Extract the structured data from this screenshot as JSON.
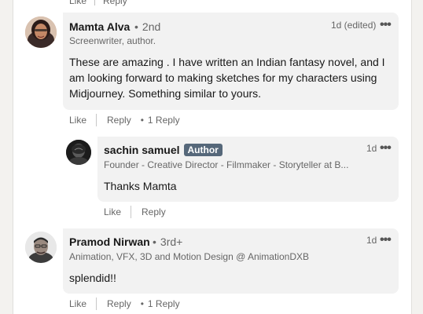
{
  "top_actions": {
    "like": "Like",
    "reply": "Reply"
  },
  "comments": [
    {
      "name": "Mamta Alva",
      "degree": "2nd",
      "headline": "Screenwriter, author.",
      "time": "1d (edited)",
      "text": "These are amazing . I have written an Indian fantasy novel, and I am looking forward to making sketches for my characters using Midjourney. Something similar to yours.",
      "like": "Like",
      "reply": "Reply",
      "replies": "1 Reply",
      "reply_item": {
        "name": "sachin samuel",
        "badge": "Author",
        "headline": "Founder - Creative Director - Filmmaker - Storyteller at B...",
        "time": "1d",
        "text": "Thanks Mamta",
        "like": "Like",
        "reply": "Reply"
      }
    },
    {
      "name": "Pramod Nirwan",
      "degree": "3rd+",
      "headline": "Animation, VFX, 3D and Motion Design @ AnimationDXB",
      "time": "1d",
      "text": "splendid!!",
      "like": "Like",
      "reply": "Reply",
      "replies": "1 Reply"
    }
  ],
  "more_icon": "•••",
  "dot": "•"
}
